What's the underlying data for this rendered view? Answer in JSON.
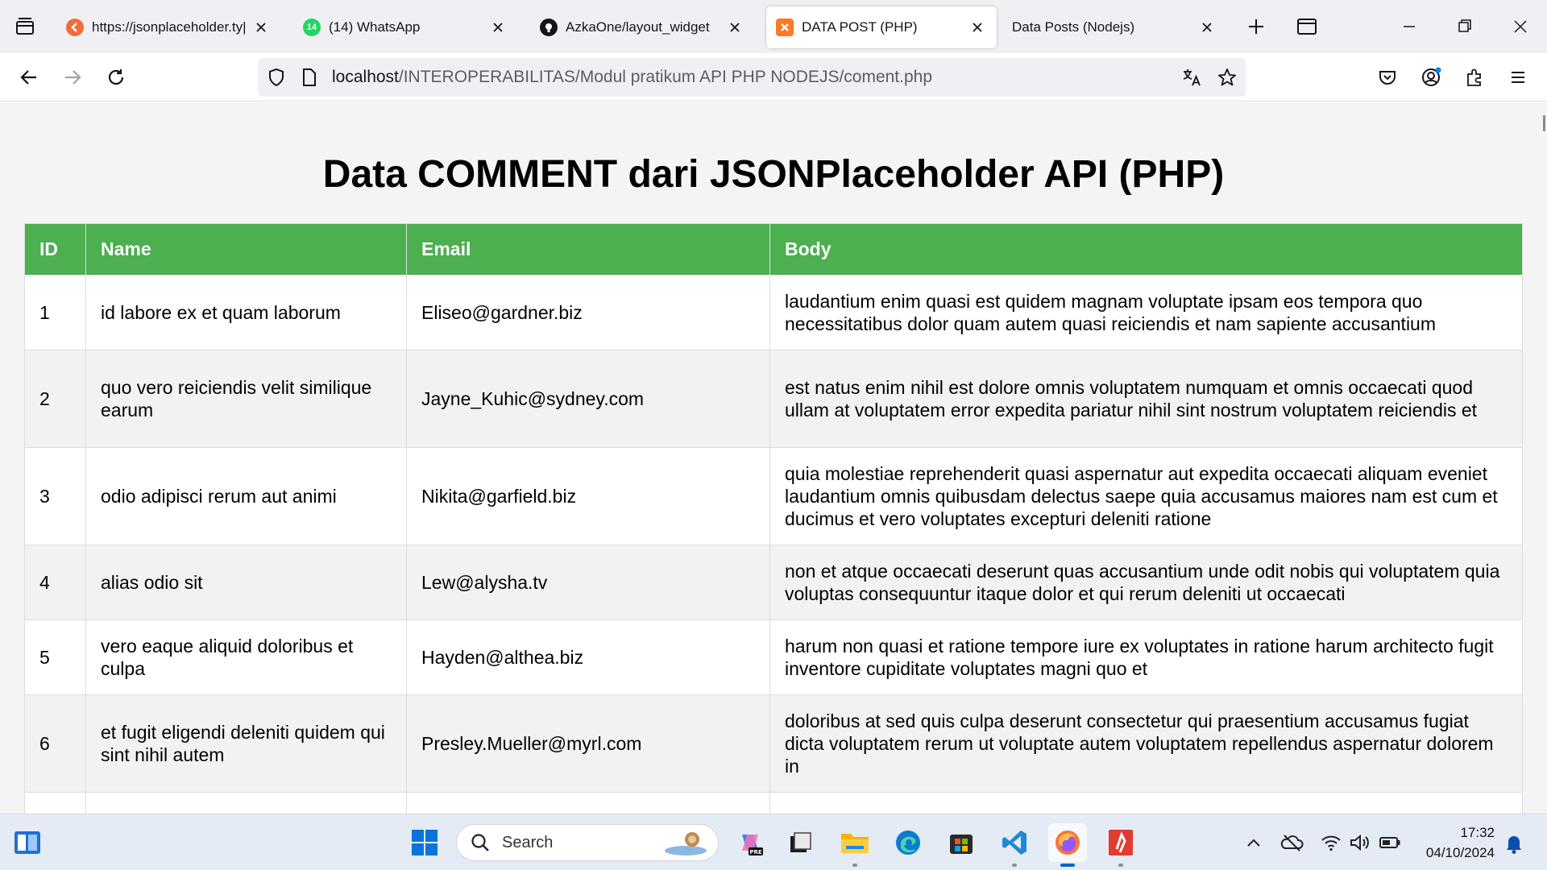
{
  "browser": {
    "tabs": [
      {
        "label": "https://jsonplaceholder.ty|",
        "icon": "jsonplaceholder-favicon-icon",
        "active": false
      },
      {
        "label": "(14) WhatsApp",
        "icon": "whatsapp-icon",
        "badge": "14",
        "active": false
      },
      {
        "label": "AzkaOne/layout_widget",
        "icon": "github-icon",
        "active": false
      },
      {
        "label": "DATA POST (PHP)",
        "icon": "xampp-icon",
        "active": true
      },
      {
        "label": "Data Posts (Nodejs)",
        "icon": "",
        "active": false
      }
    ],
    "address_host": "localhost",
    "address_path": "/INTEROPERABILITAS/Modul pratikum API PHP NODEJS/coment.php"
  },
  "page": {
    "heading": "Data COMMENT dari JSONPlaceholder API (PHP)",
    "columns": [
      "ID",
      "Name",
      "Email",
      "Body"
    ],
    "rows": [
      {
        "id": "1",
        "name": "id labore ex et quam laborum",
        "email": "Eliseo@gardner.biz",
        "body": "laudantium enim quasi est quidem magnam voluptate ipsam eos tempora quo necessitatibus dolor quam autem quasi reiciendis et nam sapiente accusantium"
      },
      {
        "id": "2",
        "name": "quo vero reiciendis velit similique earum",
        "email": "Jayne_Kuhic@sydney.com",
        "body": "est natus enim nihil est dolore omnis voluptatem numquam et omnis occaecati quod ullam at voluptatem error expedita pariatur nihil sint nostrum voluptatem reiciendis et"
      },
      {
        "id": "3",
        "name": "odio adipisci rerum aut animi",
        "email": "Nikita@garfield.biz",
        "body": "quia molestiae reprehenderit quasi aspernatur aut expedita occaecati aliquam eveniet laudantium omnis quibusdam delectus saepe quia accusamus maiores nam est cum et ducimus et vero voluptates excepturi deleniti ratione"
      },
      {
        "id": "4",
        "name": "alias odio sit",
        "email": "Lew@alysha.tv",
        "body": "non et atque occaecati deserunt quas accusantium unde odit nobis qui voluptatem quia voluptas consequuntur itaque dolor et qui rerum deleniti ut occaecati"
      },
      {
        "id": "5",
        "name": "vero eaque aliquid doloribus et culpa",
        "email": "Hayden@althea.biz",
        "body": "harum non quasi et ratione tempore iure ex voluptates in ratione harum architecto fugit inventore cupiditate voluptates magni quo et"
      },
      {
        "id": "6",
        "name": "et fugit eligendi deleniti quidem qui sint nihil autem",
        "email": "Presley.Mueller@myrl.com",
        "body": "doloribus at sed quis culpa deserunt consectetur qui praesentium accusamus fugiat dicta voluptatem rerum ut voluptate autem voluptatem repellendus aspernatur dolorem in"
      },
      {
        "id": "",
        "name": "",
        "email": "",
        "body": ""
      }
    ]
  },
  "taskbar": {
    "search_placeholder": "Search",
    "time": "17:32",
    "date": "04/10/2024"
  },
  "colors": {
    "header_green": "#4caf50",
    "accent_blue": "#0067c0"
  }
}
